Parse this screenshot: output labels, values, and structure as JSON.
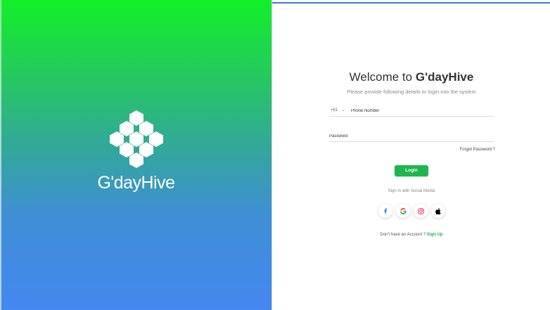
{
  "brand": {
    "name": "G'dayHive",
    "logo_icon": "hexagon-cluster-icon",
    "gradient_top": "#12f028",
    "gradient_bottom": "#4488f0"
  },
  "login": {
    "title_prefix": "Welcome to",
    "title_brand": "G'dayHive",
    "subtitle": "Please provide following details to login into the system",
    "country_code": "+61",
    "phone_placeholder": "Phone Number",
    "password_placeholder": "Password",
    "forgot_password": "Forgot Password ?",
    "login_button": "Login",
    "social_label": "Sign in with Social Media",
    "social": [
      {
        "name": "facebook-icon",
        "color": "#1877f2"
      },
      {
        "name": "google-icon",
        "color": "#4285f4"
      },
      {
        "name": "instagram-icon",
        "color": "#e1306c"
      },
      {
        "name": "apple-icon",
        "color": "#000000"
      }
    ],
    "no_account_text": "Don't have an Account ?",
    "sign_up": "Sign Up"
  },
  "colors": {
    "accent": "#1fb54e",
    "top_line": "#3a7be0"
  }
}
